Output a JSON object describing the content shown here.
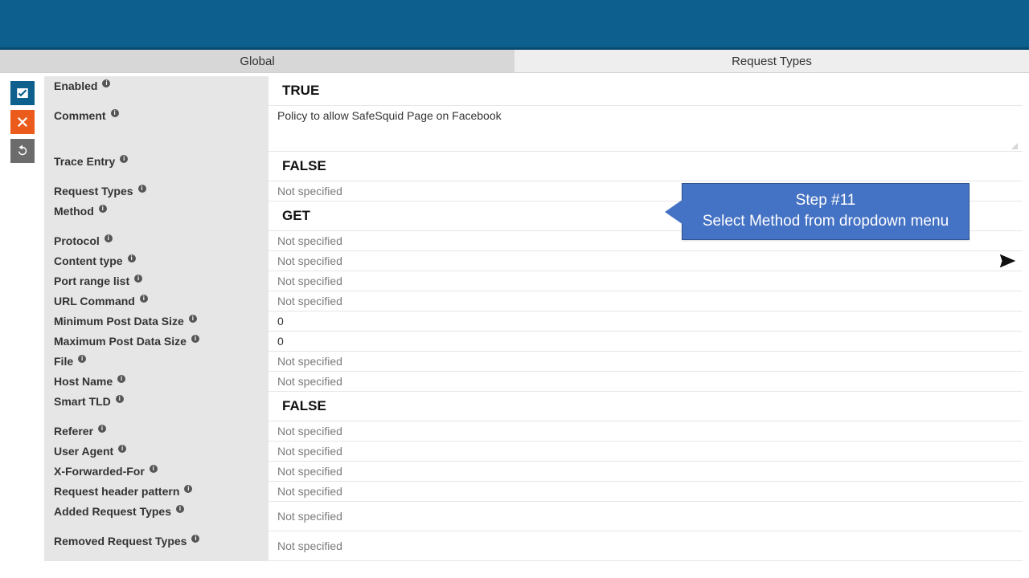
{
  "tabs": {
    "global": "Global",
    "request_types": "Request Types"
  },
  "side": {
    "save": "Save",
    "cancel": "Cancel",
    "undo": "Undo"
  },
  "callout": {
    "title": "Step #11",
    "text": "Select Method from dropdown menu"
  },
  "not_specified": "Not specified",
  "fields": {
    "enabled": {
      "label": "Enabled",
      "value": "TRUE"
    },
    "comment": {
      "label": "Comment",
      "value": "Policy to allow SafeSquid Page on Facebook"
    },
    "trace_entry": {
      "label": "Trace Entry",
      "value": "FALSE"
    },
    "request_types": {
      "label": "Request Types",
      "value": "Not specified"
    },
    "method": {
      "label": "Method",
      "value": "GET"
    },
    "protocol": {
      "label": "Protocol",
      "value": "Not specified"
    },
    "content_type": {
      "label": "Content type",
      "value": "Not specified"
    },
    "port_range_list": {
      "label": "Port range list",
      "value": "Not specified"
    },
    "url_command": {
      "label": "URL Command",
      "value": "Not specified"
    },
    "min_post": {
      "label": "Minimum Post Data Size",
      "value": "0"
    },
    "max_post": {
      "label": "Maximum Post Data Size",
      "value": "0"
    },
    "file": {
      "label": "File",
      "value": "Not specified"
    },
    "host_name": {
      "label": "Host Name",
      "value": "Not specified"
    },
    "smart_tld": {
      "label": "Smart TLD",
      "value": "FALSE"
    },
    "referer": {
      "label": "Referer",
      "value": "Not specified"
    },
    "user_agent": {
      "label": "User Agent",
      "value": "Not specified"
    },
    "x_forwarded_for": {
      "label": "X-Forwarded-For",
      "value": "Not specified"
    },
    "req_header_pattern": {
      "label": "Request header pattern",
      "value": "Not specified"
    },
    "added_request_types": {
      "label": "Added Request Types",
      "value": "Not specified"
    },
    "removed_request_types": {
      "label": "Removed Request Types",
      "value": "Not specified"
    }
  }
}
